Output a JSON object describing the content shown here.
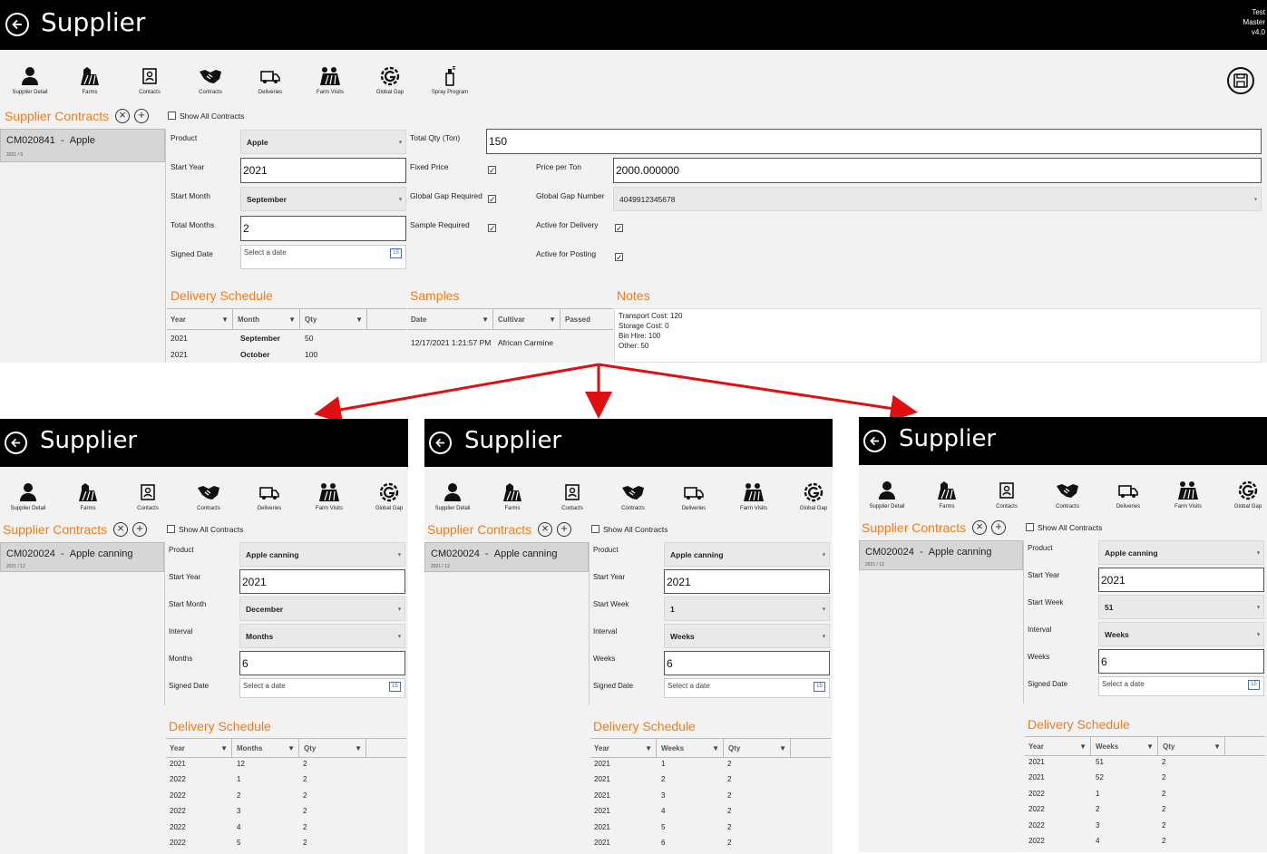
{
  "app_title": "Supplier",
  "version_text": "Test\nMaster\nv4.0",
  "colors": {
    "accent": "#f07c1a",
    "arrow": "#e01010",
    "titlebar": "#000000"
  },
  "nav": [
    "Supplier Detail",
    "Farms",
    "Contacts",
    "Contracts",
    "Deliveries",
    "Farm Visits",
    "Global Gap",
    "Spray Program"
  ],
  "nav_icons": [
    "person-icon",
    "farm-icon",
    "contact-card-icon",
    "handshake-icon",
    "truck-icon",
    "farm-visits-icon",
    "global-gap-icon",
    "spray-icon"
  ],
  "common": {
    "supplier_contracts": "Supplier Contracts",
    "show_all": "Show All Contracts",
    "product_label": "Product",
    "start_year_label": "Start Year",
    "signed_date_label": "Signed Date",
    "select_date": "Select a date",
    "delivery_schedule": "Delivery Schedule",
    "year_hdr": "Year",
    "qty_hdr": "Qty",
    "interval_label": "Interval",
    "calendar_day": "15"
  },
  "top": {
    "contract_id": "CM020841",
    "contract_sep": "-",
    "contract_product": "Apple",
    "contract_sub": "2021   /   9",
    "product": "Apple",
    "start_year": "2021",
    "start_month_label": "Start Month",
    "start_month": "September",
    "total_months_label": "Total Months",
    "total_months": "2",
    "total_qty_label": "Total Qty (Ton)",
    "total_qty": "150",
    "fixed_price_label": "Fixed Price",
    "price_per_ton_label": "Price per Ton",
    "price_per_ton": "2000.000000",
    "global_gap_required_label": "Global Gap Required",
    "global_gap_number_label": "Global Gap Number",
    "global_gap_number": "4049912345678",
    "sample_required_label": "Sample Required",
    "active_delivery_label": "Active for Delivery",
    "active_posting_label": "Active for Posting",
    "samples_title": "Samples",
    "notes_title": "Notes",
    "month_hdr": "Month",
    "date_hdr": "Date",
    "cultivar_hdr": "Cultivar",
    "passed_hdr": "Passed",
    "schedule": [
      {
        "year": "2021",
        "month": "September",
        "qty": "50"
      },
      {
        "year": "2021",
        "month": "October",
        "qty": "100"
      }
    ],
    "sample": {
      "date": "12/17/2021 1:21:57 PM",
      "cultivar": "African Carmine"
    },
    "notes": [
      "Transport Cost: 120",
      "Storage Cost: 0",
      "Bin Hire: 100",
      "Other: 50"
    ]
  },
  "panel1": {
    "contract_id": "CM020024",
    "contract_sep": "-",
    "contract_product": "Apple canning",
    "contract_sub": "2021   /   12",
    "product": "Apple canning",
    "start_year": "2021",
    "start_label": "Start Month",
    "start_value": "December",
    "interval": "Months",
    "count_label": "Months",
    "count": "6",
    "col2_hdr": "Months",
    "rows": [
      [
        "2021",
        "12",
        "2"
      ],
      [
        "2022",
        "1",
        "2"
      ],
      [
        "2022",
        "2",
        "2"
      ],
      [
        "2022",
        "3",
        "2"
      ],
      [
        "2022",
        "4",
        "2"
      ],
      [
        "2022",
        "5",
        "2"
      ]
    ]
  },
  "panel2": {
    "contract_id": "CM020024",
    "contract_sep": "-",
    "contract_product": "Apple canning",
    "contract_sub": "2021   /   12",
    "product": "Apple canning",
    "start_year": "2021",
    "start_label": "Start Week",
    "start_value": "1",
    "interval": "Weeks",
    "count_label": "Weeks",
    "count": "6",
    "col2_hdr": "Weeks",
    "rows": [
      [
        "2021",
        "1",
        "2"
      ],
      [
        "2021",
        "2",
        "2"
      ],
      [
        "2021",
        "3",
        "2"
      ],
      [
        "2021",
        "4",
        "2"
      ],
      [
        "2021",
        "5",
        "2"
      ],
      [
        "2021",
        "6",
        "2"
      ]
    ]
  },
  "panel3": {
    "contract_id": "CM020024",
    "contract_sep": "-",
    "contract_product": "Apple canning",
    "contract_sub": "2021   /   12",
    "product": "Apple canning",
    "start_year": "2021",
    "start_label": "Start Week",
    "start_value": "51",
    "interval": "Weeks",
    "count_label": "Weeks",
    "count": "6",
    "col2_hdr": "Weeks",
    "rows": [
      [
        "2021",
        "51",
        "2"
      ],
      [
        "2021",
        "52",
        "2"
      ],
      [
        "2022",
        "1",
        "2"
      ],
      [
        "2022",
        "2",
        "2"
      ],
      [
        "2022",
        "3",
        "2"
      ],
      [
        "2022",
        "4",
        "2"
      ]
    ]
  }
}
